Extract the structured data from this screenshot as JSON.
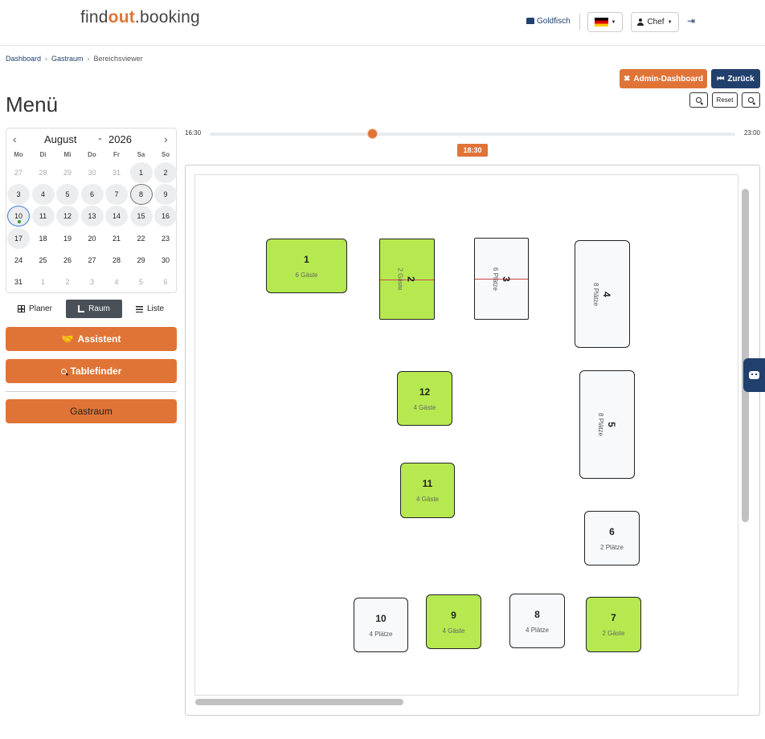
{
  "header": {
    "logo_pre": "find",
    "logo_mid": "out",
    "logo_post": ".booking",
    "restaurant": "Goldfisch",
    "user": "Chef"
  },
  "breadcrumb": [
    "Dashboard",
    "Gastraum",
    "Bereichsviewer"
  ],
  "buttons": {
    "admin": "Admin-Dashboard",
    "back": "Zurück",
    "reset": "Reset"
  },
  "page_title": "Menü",
  "calendar": {
    "month": "August",
    "year": "2026",
    "weekdays": [
      "Mo",
      "Di",
      "Mi",
      "Do",
      "Fr",
      "Sa",
      "So"
    ],
    "weeks": [
      [
        "27",
        "28",
        "29",
        "30",
        "31",
        "1",
        "2"
      ],
      [
        "3",
        "4",
        "5",
        "6",
        "7",
        "8",
        "9"
      ],
      [
        "10",
        "11",
        "12",
        "13",
        "14",
        "15",
        "16"
      ],
      [
        "17",
        "18",
        "19",
        "20",
        "21",
        "22",
        "23"
      ],
      [
        "24",
        "25",
        "26",
        "27",
        "28",
        "29",
        "30"
      ],
      [
        "31",
        "1",
        "2",
        "3",
        "4",
        "5",
        "6"
      ]
    ],
    "selected_day": "8",
    "today": "10"
  },
  "views": {
    "planer": "Planer",
    "raum": "Raum",
    "liste": "Liste",
    "active": "Raum"
  },
  "actions": {
    "assistant": "Assistent",
    "tablefinder": "Tablefinder",
    "area": "Gastraum"
  },
  "timeline": {
    "min": "16:30",
    "max": "23:00",
    "value": "18:30"
  },
  "tables": [
    {
      "num": "1",
      "sub": "6 Gäste",
      "status": "occupied"
    },
    {
      "num": "2",
      "sub": "2 Gäste",
      "status": "occupied"
    },
    {
      "num": "3",
      "sub": "6 Plätze",
      "status": "free"
    },
    {
      "num": "4",
      "sub": "8 Plätze",
      "status": "free"
    },
    {
      "num": "12",
      "sub": "4 Gäste",
      "status": "occupied"
    },
    {
      "num": "5",
      "sub": "8 Plätze",
      "status": "free"
    },
    {
      "num": "11",
      "sub": "4 Gäste",
      "status": "occupied"
    },
    {
      "num": "6",
      "sub": "2 Plätze",
      "status": "free"
    },
    {
      "num": "10",
      "sub": "4 Plätze",
      "status": "free"
    },
    {
      "num": "9",
      "sub": "4 Gäste",
      "status": "occupied"
    },
    {
      "num": "8",
      "sub": "4 Plätze",
      "status": "free"
    },
    {
      "num": "7",
      "sub": "2 Gäste",
      "status": "occupied"
    }
  ],
  "colors": {
    "accent": "#e07436",
    "navy": "#22406d",
    "occupied": "#b6e950",
    "free": "#f8f9fa"
  }
}
